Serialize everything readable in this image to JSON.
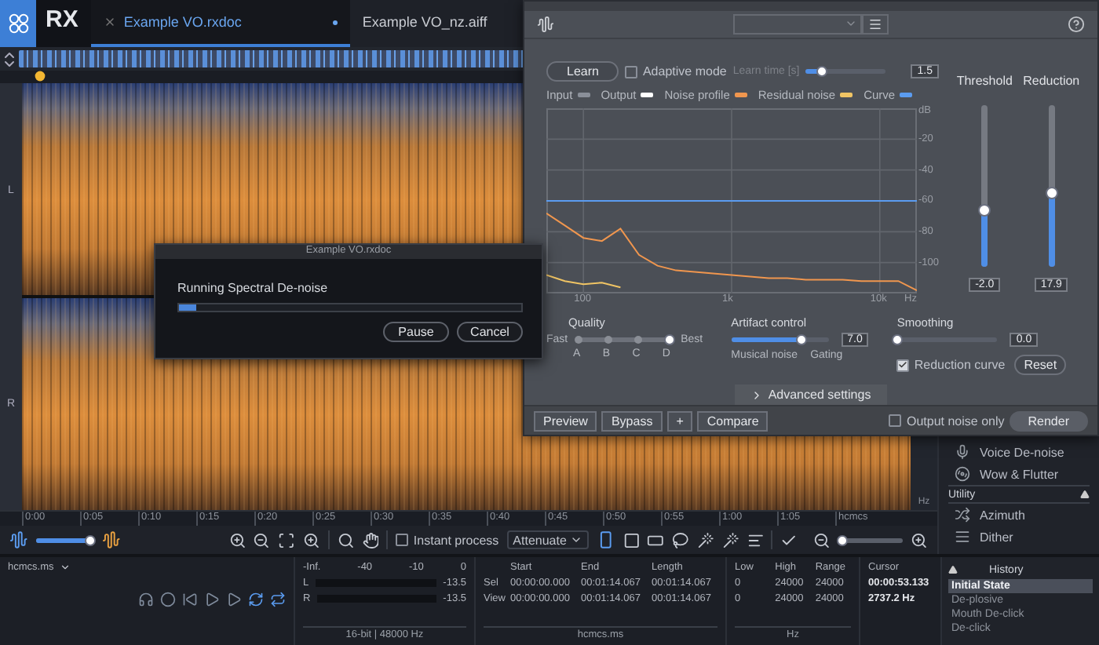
{
  "app": {
    "logo": "RX"
  },
  "tabs": [
    {
      "label": "Example VO.rxdoc",
      "selected": true,
      "modified": true
    },
    {
      "label": "Example VO_nz.aiff",
      "selected": false,
      "modified": false
    }
  ],
  "spectrogram": {
    "channels": [
      "L",
      "R"
    ],
    "scale_unit": "Hz"
  },
  "time_ruler": [
    "0:00",
    "0:05",
    "0:10",
    "0:15",
    "0:20",
    "0:25",
    "0:30",
    "0:35",
    "0:40",
    "0:45",
    "0:50",
    "0:55",
    "1:00",
    "1:05",
    "hcmcs"
  ],
  "toolbar": {
    "gain": {
      "level": 0.92
    },
    "instant_process": {
      "label": "Instant process",
      "checked": false
    },
    "mode": "Attenuate",
    "zoom": {
      "level": 0.05
    }
  },
  "plugin": {
    "learn": "Learn",
    "adaptive_mode": {
      "label": "Adaptive mode",
      "checked": false
    },
    "learn_time": {
      "label": "Learn time [s]",
      "level": 0.2,
      "value": "1.5"
    },
    "legend": [
      {
        "label": "Input",
        "color": "#8a8f99"
      },
      {
        "label": "Output",
        "color": "#ffffff"
      }
    ],
    "chart_data": {
      "type": "line",
      "xlabel": "Hz",
      "ylabel": "dB",
      "categories": [
        null,
        null,
        "100",
        null,
        null,
        null,
        null,
        null,
        null,
        null,
        "1k",
        null,
        null,
        null,
        null,
        null,
        null,
        null,
        "10k",
        null,
        null
      ],
      "ylim": [
        -120,
        0
      ],
      "yticks": [
        -20,
        -40,
        -60,
        -80,
        -100
      ],
      "grid": true,
      "series": [
        {
          "name": "Noise profile",
          "color": "#f0964e",
          "values": [
            -68,
            -76,
            -84,
            -86,
            -78,
            -95,
            -102,
            -105,
            -106,
            -107,
            -108,
            -109,
            -110,
            -110,
            -111,
            -111,
            -111,
            -112,
            -112,
            -112,
            -118
          ]
        },
        {
          "name": "Residual noise",
          "color": "#f0c464",
          "values": [
            -108,
            -112,
            -114,
            -113,
            -116,
            null,
            null,
            null,
            null,
            null,
            null,
            null,
            null,
            null,
            null,
            null,
            null,
            null,
            null,
            null,
            null
          ]
        },
        {
          "name": "Curve",
          "color": "#5b9cf0",
          "values": [
            -60,
            -60,
            -60,
            -60,
            -60,
            -60,
            -60,
            -60,
            -60,
            -60,
            -60,
            -60,
            -60,
            -60,
            -60,
            -60,
            -60,
            -60,
            -60,
            -60,
            -60
          ]
        }
      ]
    },
    "threshold": {
      "label": "Threshold",
      "level": 0.35,
      "value": "-2.0"
    },
    "reduction": {
      "label": "Reduction",
      "level": 0.46,
      "value": "17.9"
    },
    "quality": {
      "label": "Quality",
      "low": "Fast",
      "high": "Best",
      "options": [
        {
          "label": "A",
          "selected": false
        },
        {
          "label": "B",
          "selected": false
        },
        {
          "label": "C",
          "selected": false
        },
        {
          "label": "D",
          "selected": true
        }
      ]
    },
    "artifact": {
      "label": "Artifact control",
      "level": 0.73,
      "value": "7.0",
      "low": "Musical noise",
      "high": "Gating"
    },
    "smoothing": {
      "label": "Smoothing",
      "level": 0,
      "value": "0.0"
    },
    "reduction_curve": {
      "label": "Reduction curve",
      "checked": true
    },
    "reset": "Reset",
    "advanced": "Advanced settings",
    "footer": {
      "preview": "Preview",
      "bypass": "Bypass",
      "plus": "+",
      "compare": "Compare",
      "output_noise_only": {
        "label": "Output noise only",
        "checked": false
      },
      "render": "Render"
    }
  },
  "dialog": {
    "title": "Example VO.rxdoc",
    "message": "Running Spectral De-noise",
    "level": 0.05,
    "buttons": [
      "Pause",
      "Cancel"
    ]
  },
  "modules": [
    {
      "kind": "module",
      "label": "Voice De-noise"
    },
    {
      "kind": "module",
      "label": "Wow & Flutter"
    },
    {
      "kind": "header",
      "label": "Utility"
    },
    {
      "kind": "module",
      "label": "Azimuth"
    },
    {
      "kind": "module",
      "label": "Dither"
    }
  ],
  "history": {
    "title": "History",
    "items": [
      {
        "label": "Initial State",
        "selected": true
      },
      {
        "label": "De-plosive",
        "selected": false
      },
      {
        "label": "Mouth De-click",
        "selected": false
      },
      {
        "label": "De-click",
        "selected": false
      }
    ]
  },
  "bottom": {
    "file": "hcmcs.ms",
    "meter_scale": [
      "-Inf.",
      "-40",
      "-10",
      "0"
    ],
    "meters": [
      {
        "channel": "L",
        "reading": "-13.5"
      },
      {
        "channel": "R",
        "reading": "-13.5"
      }
    ],
    "format": "16-bit | 48000 Hz",
    "selection": {
      "columns": [
        "Start",
        "End",
        "Length"
      ],
      "rows": [
        {
          "label": "Sel",
          "values": [
            "00:00:00.000",
            "00:01:14.067",
            "00:01:14.067"
          ]
        },
        {
          "label": "View",
          "values": [
            "00:00:00.000",
            "00:01:14.067",
            "00:01:14.067"
          ]
        }
      ],
      "footer": "hcmcs.ms"
    },
    "frequency": {
      "columns": [
        "Low",
        "High",
        "Range"
      ],
      "rows": [
        [
          "0",
          "24000",
          "24000"
        ],
        [
          "0",
          "24000",
          "24000"
        ]
      ],
      "footer": "Hz"
    },
    "cursor": {
      "label": "Cursor",
      "time": "00:00:53.133",
      "frequency": "2737.2 Hz"
    }
  }
}
